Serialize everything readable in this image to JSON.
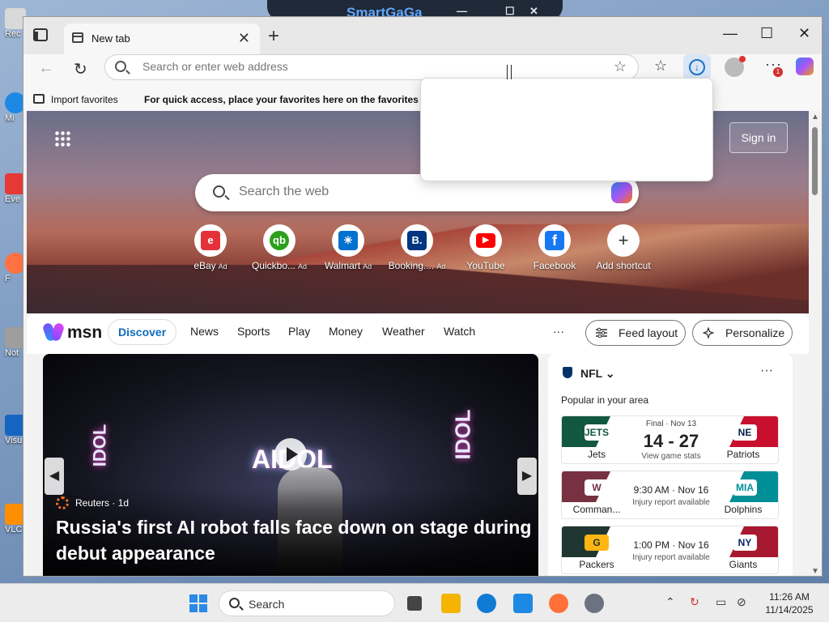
{
  "desktop": {
    "icons": [
      {
        "label": "Rec",
        "color": "#d9d9d9"
      },
      {
        "label": "Mi",
        "color": "#1e88e5"
      },
      {
        "label": "Eve",
        "color": "#e53935"
      },
      {
        "label": "F",
        "color": "#ff7043"
      },
      {
        "label": "Not",
        "color": "#9e9e9e"
      },
      {
        "label": "Visu",
        "color": "#1565c0"
      },
      {
        "label": "VLC",
        "color": "#ff8f00"
      }
    ],
    "bg_window_title": "SmartGaGa"
  },
  "browser": {
    "tab": {
      "title": "New tab",
      "close": "✕"
    },
    "newtab": "+",
    "window_controls": {
      "minimize": "—",
      "maximize": "☐",
      "close": "✕"
    },
    "nav": {
      "back": "←",
      "refresh": "↻"
    },
    "address": {
      "placeholder": "Search or enter web address",
      "star": "☆"
    },
    "toolbar": {
      "favorites": "☆",
      "download": "↓",
      "more": "···",
      "notif_count": "1"
    },
    "favbar": {
      "import": "Import favorites",
      "message": "For quick access, place your favorites here on the favorites bar."
    }
  },
  "newtab": {
    "signin": "Sign in",
    "search_placeholder": "Search the web",
    "shortcuts": [
      {
        "label": "eBay",
        "ad": "Ad",
        "logo": "e",
        "color": "#e53238"
      },
      {
        "label": "Quickbo...",
        "ad": "Ad",
        "logo": "qb",
        "color": "#2ca01c"
      },
      {
        "label": "Walmart",
        "ad": "Ad",
        "logo": "✳",
        "color": "#0071ce"
      },
      {
        "label": "Booking....",
        "ad": "Ad",
        "logo": "B.",
        "color": "#003580"
      },
      {
        "label": "YouTube",
        "ad": "",
        "logo": "▶",
        "color": "#ff0000"
      },
      {
        "label": "Facebook",
        "ad": "",
        "logo": "f",
        "color": "#1877f2"
      },
      {
        "label": "Add shortcut",
        "ad": "",
        "logo": "+",
        "color": "#ffffff"
      }
    ]
  },
  "feed": {
    "brand": "msn",
    "tabs": [
      "Discover",
      "News",
      "Sports",
      "Play",
      "Money",
      "Weather",
      "Watch"
    ],
    "more": "···",
    "feed_layout": "Feed layout",
    "personalize": "Personalize",
    "story": {
      "source": "Reuters",
      "age": "1d",
      "headline": "Russia's first AI robot falls face down on stage during debut appearance",
      "sign_text": "AIDOL",
      "side_text": "IDOL"
    },
    "nfl": {
      "league": "NFL",
      "popular": "Popular in your area",
      "games": [
        {
          "status": "Final · Nov 13",
          "score": "14 - 27",
          "detail": "View game stats",
          "home": "Jets",
          "away": "Patriots",
          "home_color": "#125740",
          "away_color": "#c8102e",
          "home_mark": "JETS",
          "away_mark": "NE"
        },
        {
          "status": "",
          "time": "9:30 AM · Nov 16",
          "detail": "Injury report available",
          "home": "Comman...",
          "away": "Dolphins",
          "home_color": "#773141",
          "away_color": "#008e97",
          "home_mark": "W",
          "away_mark": "MIA"
        },
        {
          "status": "",
          "time": "1:00 PM · Nov 16",
          "detail": "Injury report available",
          "home": "Packers",
          "away": "Giants",
          "home_color": "#203731",
          "away_color": "#a71930",
          "home_mark": "G",
          "away_mark": "NY"
        }
      ]
    }
  },
  "taskbar": {
    "search": "Search",
    "time": "11:26 AM",
    "date": "11/14/2025",
    "apps": [
      {
        "name": "task-view",
        "color": "#444444"
      },
      {
        "name": "file-explorer",
        "color": "#f4b400"
      },
      {
        "name": "edge",
        "color": "#0f7bd4"
      },
      {
        "name": "smartgaga",
        "color": "#1e88e5"
      },
      {
        "name": "firefox",
        "color": "#ff7139"
      },
      {
        "name": "settings",
        "color": "#6b7280"
      }
    ]
  }
}
